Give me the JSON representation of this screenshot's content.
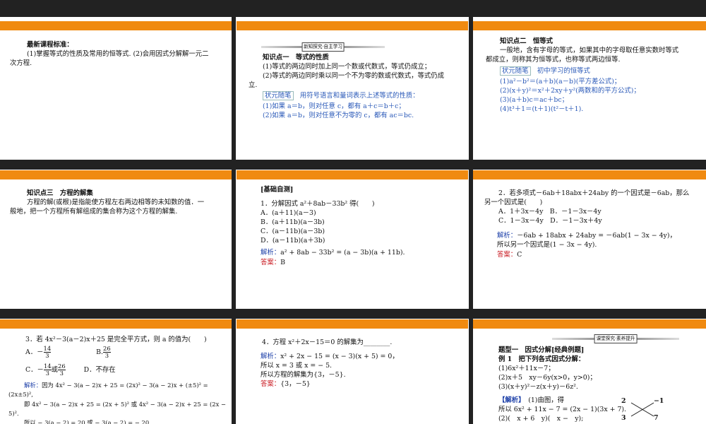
{
  "s1": {
    "title": "最新课程标准：",
    "line1": "(1)掌握等式的性质及常用的恒等式. (2)会用因式分解解一元二",
    "line2": "次方程."
  },
  "s2": {
    "banner": "新知探究·自主学习",
    "heading": "知识点一　等式的性质",
    "p1": "(1)等式的两边同时加上同一个数或代数式，等式仍成立；",
    "p2a": "(2)等式的两边同时乘以同一个不为零的数或代数式，等式仍成",
    "p2b": "立.",
    "note_tag": "状元随笔",
    "note_text": "　用符号语言和量词表示上述等式的性质：",
    "n1": "(1)如果 a＝b，则对任意 c，都有 a＋c＝b＋c；",
    "n2": "(2)如果 a＝b，则对任意不为零的 c，都有 ac＝bc."
  },
  "s3": {
    "heading": "知识点二　恒等式",
    "p1": "一般地，含有字母的等式，如果其中的字母取任意实数时等式",
    "p2": "都成立，则称其为恒等式，也称等式两边恒等.",
    "note_tag": "状元随笔",
    "note_text": "　初中学习的恒等式",
    "f1": "(1)a²－b²＝(a＋b)(a－b)(平方差公式)；",
    "f2": "(2)(x＋y)²＝x²＋2xy＋y²(两数和的平方公式)；",
    "f3": "(3)(a＋b)c＝ac＋bc；",
    "f4": "(4)t³＋1＝(t＋1)(t²－t＋1)."
  },
  "s4": {
    "heading": "知识点三　方程的解集",
    "p1": "方程的解(或根)是指能使方程左右两边相等的未知数的值．一",
    "p2": "般地，把一个方程所有解组成的集合称为这个方程的解集."
  },
  "s5": {
    "heading": "[基础自测]",
    "q": "1．分解因式 a²＋8ab－33b² 得(　　)",
    "A": "A．(a＋11)(a－3)",
    "B": "B．(a＋11b)(a－3b)",
    "C": "C．(a－11b)(a－3b)",
    "D": "D．(a－11b)(a＋3b)",
    "jx_label": "解析：",
    "jx": "a² + 8ab − 33b² = (a − 3b)(a + 11b).",
    "da_label": "答案：",
    "da": "B"
  },
  "s6": {
    "q1": "2．若多项式－6ab＋18abx＋24aby 的一个因式是－6ab，那么",
    "q2": "另一个因式是(　　)",
    "AB": "A．1＋3x－4y　B．－1－3x－4y",
    "CD": "C．1－3x－4y　D．－1－3x＋4y",
    "jx_label": "解析：",
    "jx": "－6ab + 18abx + 24aby = －6ab(1 − 3x − 4y)，",
    "jx2": "所以另一个因式是(1 − 3x − 4y).",
    "da_label": "答案：",
    "da": "C"
  },
  "s7": {
    "q": "3．若 4x²－3(a－2)x＋25 是完全平方式，则 a 的值为(　　)",
    "A_pre": "A．－",
    "A_num": "14",
    "A_den": "3",
    "B_pre": "B.",
    "B_num": "26",
    "B_den": "3",
    "C_pre": "C．－",
    "C_num1": "14",
    "C_den1": "3",
    "C_or": "或",
    "C_num2": "26",
    "C_den2": "3",
    "D": "D．不存在",
    "jx_label": "解析：",
    "jx1": "因为 4x² − 3(a − 2)x + 25 = (2x)² − 3(a − 2)x + (±5)² =",
    "jx2": "(2x±5)²,",
    "jx3": "即 4x² − 3(a − 2)x + 25 = (2x + 5)² 或 4x² − 3(a − 2)x + 25 = (2x −",
    "jx4": "5)².",
    "jx5": "所以 − 3(a − 2) = 20 或 − 3(a − 2) = − 20"
  },
  "s8": {
    "q": "4．方程 x²＋2x－15＝0 的解集为________.",
    "jx_label": "解析：",
    "jx1": "x² + 2x − 15 = (x − 3)(x + 5) = 0，",
    "jx2": "所以 x = 3 或 x = − 5.",
    "jx3": "所以方程的解集为{3，－5}.",
    "da_label": "答案：",
    "da": "{3，－5}"
  },
  "s9": {
    "banner": "课堂探究·素养提升",
    "heading": "题型一　因式分解[经典例题]",
    "ex": "例 1　把下列各式因式分解：",
    "e1": "(1)6x²＋11x－7；",
    "e2": "(2)x＋5　xy－6y(x>0，y>0)；",
    "e3": "(3)(x＋y)²－z(x＋y)－6z².",
    "jd_label": "【解析】",
    "jd1": "　(1)由图，得",
    "jd2": "所以 6x² + 11x − 7 = (2x − 1)(3x + 7).",
    "jd3": "(2)(　x + 6　y)(　x −　y);",
    "c_tl": "2",
    "c_tr": "−1",
    "c_bl": "3",
    "c_br": "7"
  }
}
